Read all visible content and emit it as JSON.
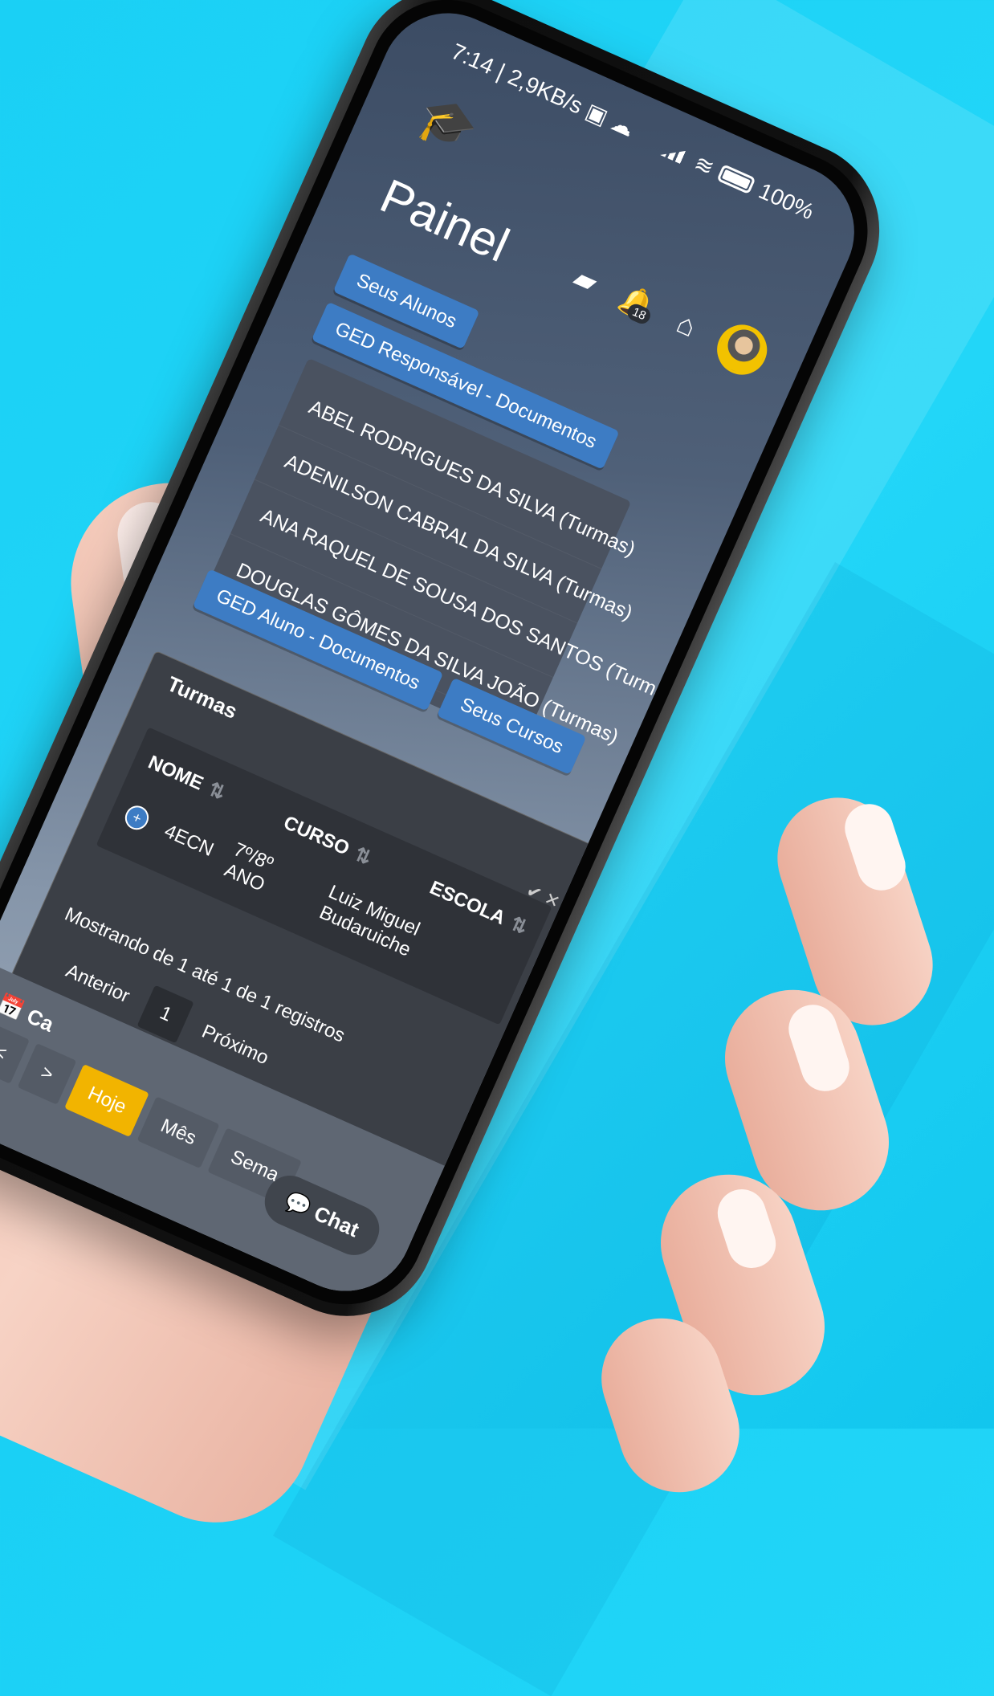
{
  "status": {
    "time": "7:14",
    "speed": "| 2,9KB/s",
    "battery": "100%"
  },
  "header": {
    "title": "Painel",
    "notifications_count": "18"
  },
  "tabs": [
    "Seus Alunos",
    "GED Responsável - Documentos"
  ],
  "students": [
    "ABEL RODRIGUES DA SILVA (Turmas)",
    "ADENILSON CABRAL DA SILVA (Turmas)",
    "ANA RAQUEL DE SOUSA DOS SANTOS (Turmas)",
    "DOUGLAS GÔMES DA SILVA JOÃO (Turmas)"
  ],
  "tabs2": [
    "GED Aluno - Documentos",
    "Seus Cursos"
  ],
  "turmas": {
    "title": "Turmas",
    "columns": [
      "NOME",
      "CURSO",
      "ESCOLA"
    ],
    "row": {
      "nome": "4ECN",
      "curso": "7º/8º ANO",
      "escola": "Luiz Miguel Budaruiche"
    },
    "info": "Mostrando de 1 até 1 de 1 registros",
    "prev": "Anterior",
    "page": "1",
    "next": "Próximo"
  },
  "calendar": {
    "label": "Ca",
    "prev": "<",
    "next": ">",
    "today": "Hoje",
    "month": "Mês",
    "week": "Sema",
    "chat": "Chat"
  }
}
